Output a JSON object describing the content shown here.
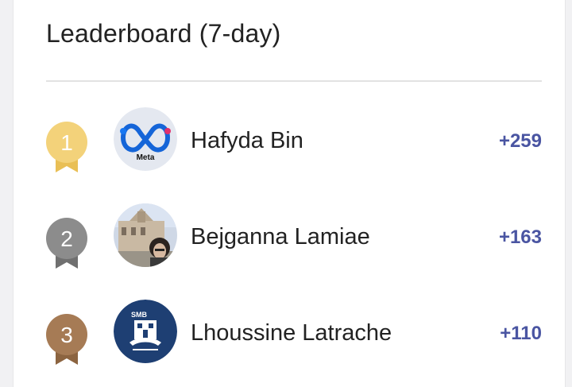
{
  "leaderboard": {
    "title": "Leaderboard (7-day)",
    "entries": [
      {
        "rank": "1",
        "name": "Hafyda Bin",
        "score": "+259",
        "medal_color": "#f3d27a",
        "medal_ribbon": "#e9bf55",
        "avatar_icon": "meta-logo-icon",
        "avatar_text": "Meta"
      },
      {
        "rank": "2",
        "name": "Bejganna Lamiae",
        "score": "+163",
        "medal_color": "#8c8c8c",
        "medal_ribbon": "#707070",
        "avatar_icon": "user-photo-icon"
      },
      {
        "rank": "3",
        "name": "Lhoussine Latrache",
        "score": "+110",
        "medal_color": "#a67b55",
        "medal_ribbon": "#8c6440",
        "avatar_icon": "smb-logo-icon",
        "avatar_text": "SMB"
      }
    ]
  },
  "colors": {
    "score": "#4a55a2",
    "text": "#222222",
    "divider": "#e2e2e2"
  }
}
